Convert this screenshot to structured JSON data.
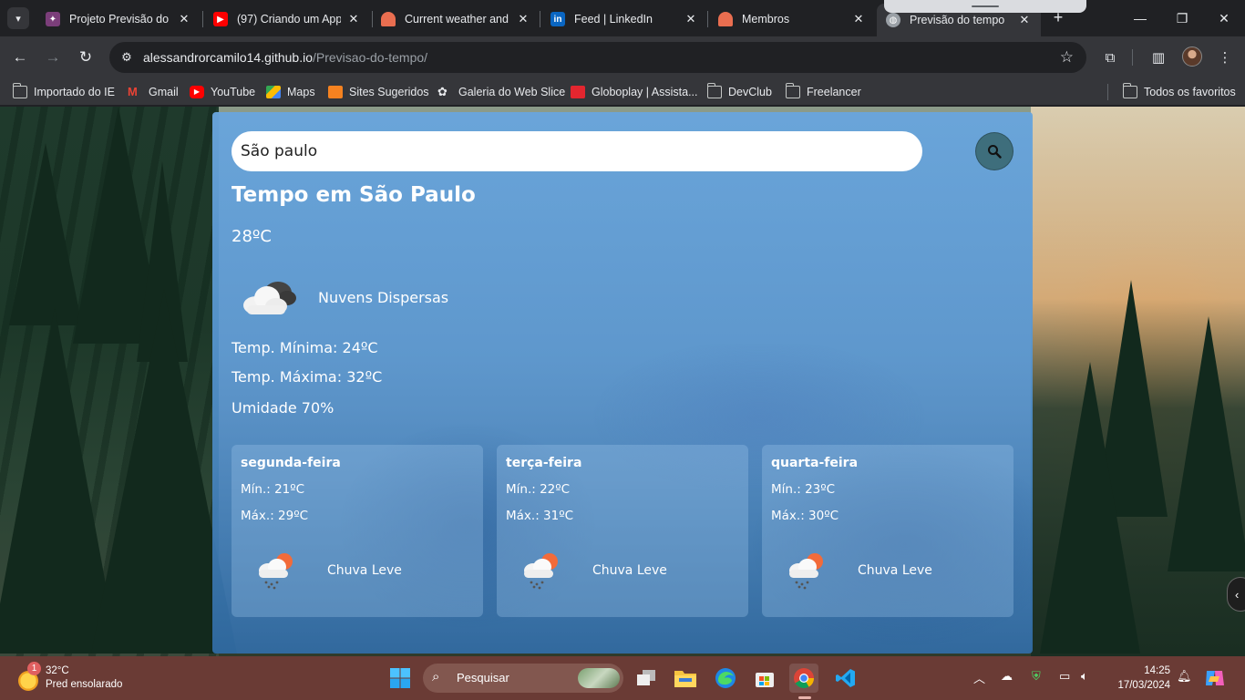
{
  "browser": {
    "tabs": [
      {
        "title": "Projeto Previsão do Te",
        "favicon": "project-icon",
        "color": "#7b3e7a"
      },
      {
        "title": "(97) Criando um App",
        "favicon": "youtube-icon",
        "color": "#ff0000"
      },
      {
        "title": "Current weather and",
        "favicon": "openweather-icon",
        "color": "#e96e50"
      },
      {
        "title": "Feed | LinkedIn",
        "favicon": "linkedin-icon",
        "color": "#0a66c2"
      },
      {
        "title": "Membros",
        "favicon": "openweather-icon",
        "color": "#e96e50"
      },
      {
        "title": "Previsão do tempo",
        "favicon": "globe-icon",
        "color": "#9aa0a6",
        "active": true
      }
    ],
    "url_host": "alessandrorcamilo14.github.io",
    "url_path": "/Previsao-do-tempo/",
    "bookmarks": [
      {
        "label": "Importado do IE",
        "icon": "folder-icon"
      },
      {
        "label": "Gmail",
        "icon": "gmail-icon"
      },
      {
        "label": "YouTube",
        "icon": "youtube-icon"
      },
      {
        "label": "Maps",
        "icon": "maps-icon"
      },
      {
        "label": "Sites Sugeridos",
        "icon": "suggested-sites-icon"
      },
      {
        "label": "Galeria do Web Slice",
        "icon": "web-slice-icon"
      },
      {
        "label": "Globoplay | Assista...",
        "icon": "globoplay-icon"
      },
      {
        "label": "DevClub",
        "icon": "folder-icon"
      },
      {
        "label": "Freelancer",
        "icon": "folder-icon"
      }
    ],
    "all_bookmarks": "Todos os favoritos"
  },
  "weather": {
    "search_value": "São paulo",
    "city_title": "Tempo em São Paulo",
    "temperature": "28ºC",
    "condition": "Nuvens Dispersas",
    "condition_icon": "broken-clouds-icon",
    "temp_min": "Temp. Mínima: 24ºC",
    "temp_max": "Temp. Máxima: 32ºC",
    "humidity": "Umidade 70%",
    "forecast": [
      {
        "day": "segunda-feira",
        "min": "Mín.: 21ºC",
        "max": "Máx.: 29ºC",
        "desc": "Chuva Leve",
        "icon": "light-rain-icon"
      },
      {
        "day": "terça-feira",
        "min": "Mín.: 22ºC",
        "max": "Máx.: 31ºC",
        "desc": "Chuva Leve",
        "icon": "light-rain-icon"
      },
      {
        "day": "quarta-feira",
        "min": "Mín.: 23ºC",
        "max": "Máx.: 30ºC",
        "desc": "Chuva Leve",
        "icon": "light-rain-icon"
      }
    ]
  },
  "taskbar": {
    "weather_temp": "32°C",
    "weather_desc": "Pred ensolarado",
    "weather_badge": "1",
    "search_label": "Pesquisar",
    "time": "14:25",
    "date": "17/03/2024"
  }
}
